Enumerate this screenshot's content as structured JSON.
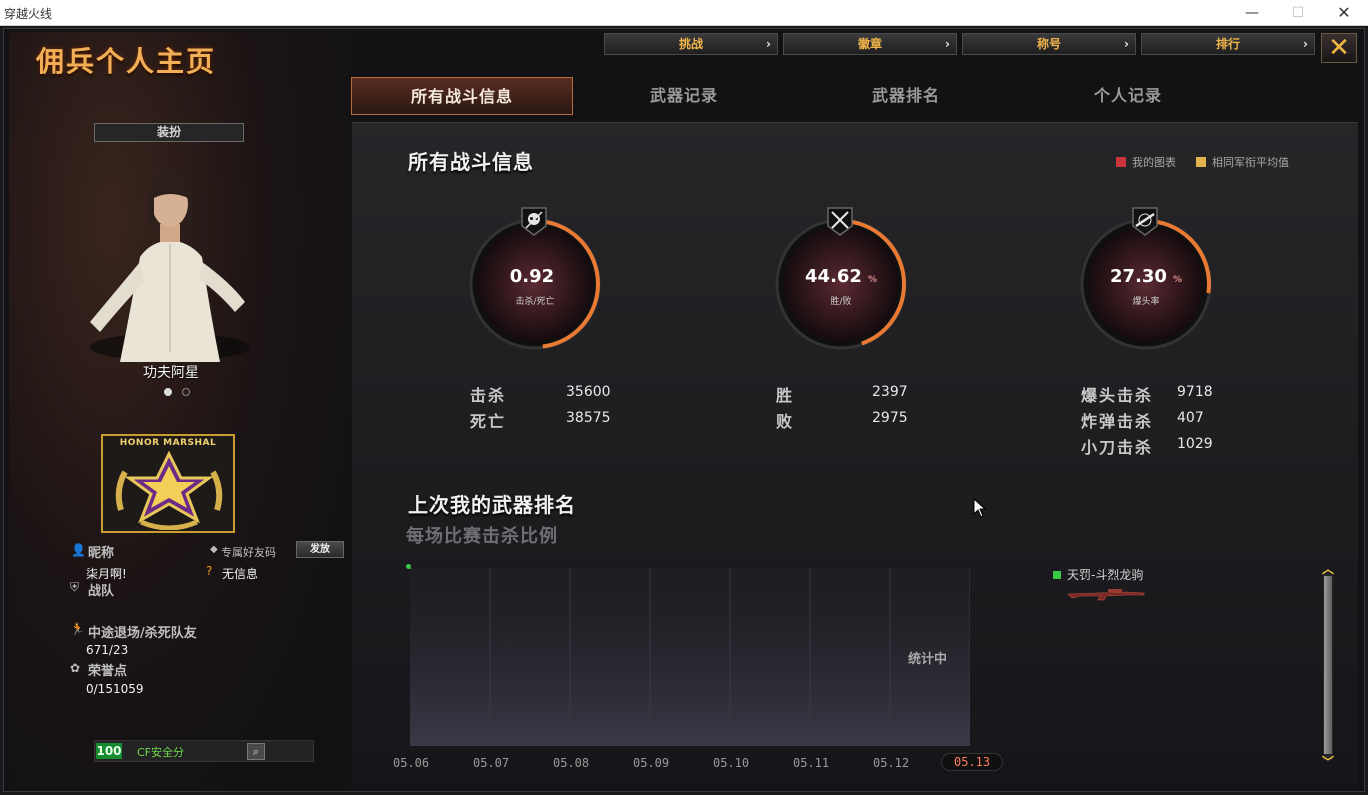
{
  "window": {
    "title": "穿越火线",
    "min": "—",
    "max": "☐",
    "close": "✕"
  },
  "header": {
    "page_title": "佣兵个人主页"
  },
  "topnav": [
    {
      "label": "挑战"
    },
    {
      "label": "徽章"
    },
    {
      "label": "称号"
    },
    {
      "label": "排行"
    }
  ],
  "tabs": [
    {
      "label": "所有战斗信息",
      "active": true
    },
    {
      "label": "武器记录"
    },
    {
      "label": "武器排名"
    },
    {
      "label": "个人记录"
    }
  ],
  "profile": {
    "outfit_label": "装扮",
    "character_name": "功夫阿星",
    "rank_badge_text": "HONOR MARSHAL",
    "nickname_label": "昵称",
    "nickname_value": "柒月啊!",
    "friend_code_label": "专属好友码",
    "friend_code_button": "发放",
    "friend_code_value": "无信息",
    "team_label": "战队",
    "quit_label": "中途退场/杀死队友",
    "quit_value": "671/23",
    "honor_label": "荣誉点",
    "honor_value": "0/151059",
    "cf_score": "100",
    "cf_score_label": "CF安全分"
  },
  "colors": {
    "accent": "#f1b056",
    "my_chart": "#c9343a",
    "avg_chart": "#e0b44a",
    "weapon_legend": "#39c948"
  },
  "battle": {
    "title": "所有战斗信息",
    "legend": [
      {
        "label": "我的图表"
      },
      {
        "label": "相同军衔平均值"
      }
    ],
    "gauges": [
      {
        "value": "0.92",
        "unit": "",
        "sub": "击杀/死亡",
        "icon": "skull-icon",
        "fill": 0.48
      },
      {
        "value": "44.62",
        "unit": "%",
        "sub": "胜/败",
        "icon": "crossed-swords-icon",
        "fill": 0.4462
      },
      {
        "value": "27.30",
        "unit": "%",
        "sub": "爆头率",
        "icon": "rifle-icon",
        "fill": 0.273
      }
    ],
    "kills_label": "击杀",
    "kills_value": "35600",
    "deaths_label": "死亡",
    "deaths_value": "38575",
    "wins_label": "胜",
    "wins_value": "2397",
    "losses_label": "败",
    "losses_value": "2975",
    "headshot_label": "爆头击杀",
    "headshot_value": "9718",
    "grenade_label": "炸弹击杀",
    "grenade_value": "407",
    "knife_label": "小刀击杀",
    "knife_value": "1029"
  },
  "weapon_rank": {
    "title": "上次我的武器排名",
    "subtitle": "每场比赛击杀比例",
    "status": "统计中",
    "weapon_legend": "天罚-斗烈龙驹"
  },
  "chart_data": {
    "type": "bar",
    "categories": [
      "05.06",
      "05.07",
      "05.08",
      "05.09",
      "05.10",
      "05.11",
      "05.12",
      "05.13"
    ],
    "selected_category": "05.13",
    "series": [],
    "title": "每场比赛击杀比例"
  }
}
